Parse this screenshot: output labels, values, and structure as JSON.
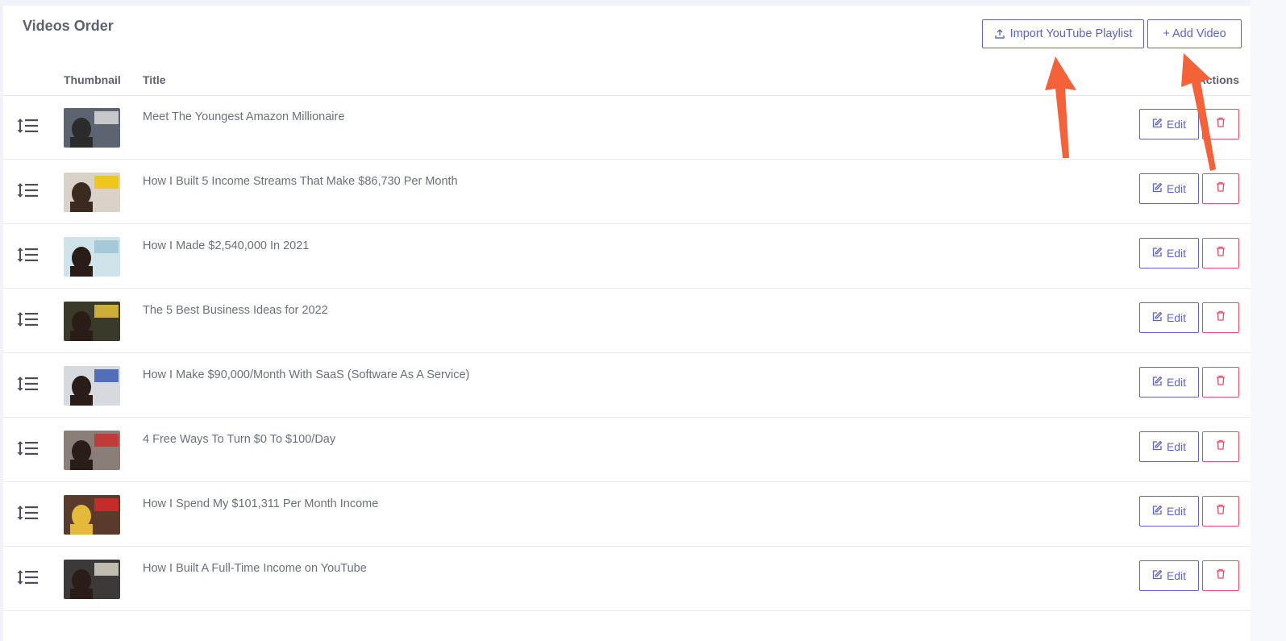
{
  "page": {
    "title": "Videos Order"
  },
  "toolbar": {
    "import_label": "Import YouTube Playlist",
    "add_label": "+ Add Video"
  },
  "table": {
    "headers": {
      "thumbnail": "Thumbnail",
      "title": "Title",
      "actions": "Actions"
    },
    "edit_label": "Edit",
    "rows": [
      {
        "title": "Meet The Youngest Amazon Millionaire"
      },
      {
        "title": "How I Built 5 Income Streams That Make $86,730 Per Month"
      },
      {
        "title": "How I Made $2,540,000 In 2021"
      },
      {
        "title": "The 5 Best Business Ideas for 2022"
      },
      {
        "title": "How I Make $90,000/Month With SaaS (Software As A Service)"
      },
      {
        "title": "4 Free Ways To Turn $0 To $100/Day"
      },
      {
        "title": "How I Spend My $101,311 Per Month Income"
      },
      {
        "title": "How I Built A Full-Time Income on YouTube"
      }
    ]
  },
  "colors": {
    "primary": "#5d63c4",
    "danger": "#e04f64",
    "annotation_arrow": "#f4623a"
  }
}
